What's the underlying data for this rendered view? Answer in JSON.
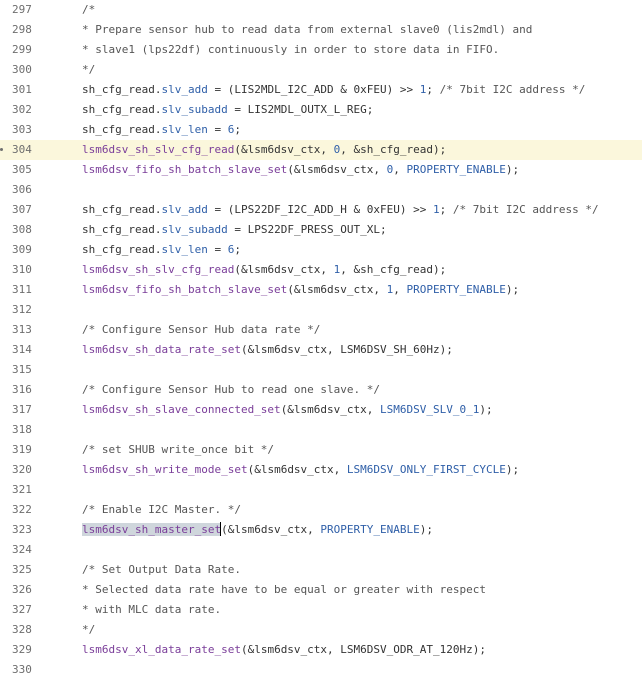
{
  "editor": {
    "highlighted_line": 304,
    "lines": [
      {
        "number": "297",
        "tokens": [
          {
            "t": "/*",
            "c": "comment"
          }
        ]
      },
      {
        "number": "298",
        "tokens": [
          {
            "t": "* Prepare sensor hub to read data from external slave0 (lis2mdl) and",
            "c": "comment"
          }
        ]
      },
      {
        "number": "299",
        "tokens": [
          {
            "t": "* slave1 (lps22df) continuously in order to store data in FIFO.",
            "c": "comment"
          }
        ]
      },
      {
        "number": "300",
        "tokens": [
          {
            "t": "*/",
            "c": "comment"
          }
        ]
      },
      {
        "number": "301",
        "tokens": [
          {
            "t": "sh_cfg_read.",
            "c": "text"
          },
          {
            "t": "slv_add",
            "c": "member"
          },
          {
            "t": " = (LIS2MDL_I2C_ADD & 0xFEU) >> ",
            "c": "text"
          },
          {
            "t": "1",
            "c": "num"
          },
          {
            "t": "; ",
            "c": "text"
          },
          {
            "t": "/* 7bit I2C address */",
            "c": "comment"
          }
        ]
      },
      {
        "number": "302",
        "tokens": [
          {
            "t": "sh_cfg_read.",
            "c": "text"
          },
          {
            "t": "slv_subadd",
            "c": "member"
          },
          {
            "t": " = LIS2MDL_OUTX_L_REG;",
            "c": "text"
          }
        ]
      },
      {
        "number": "303",
        "tokens": [
          {
            "t": "sh_cfg_read.",
            "c": "text"
          },
          {
            "t": "slv_len",
            "c": "member"
          },
          {
            "t": " = ",
            "c": "text"
          },
          {
            "t": "6",
            "c": "num"
          },
          {
            "t": ";",
            "c": "text"
          }
        ]
      },
      {
        "number": "304",
        "tokens": [
          {
            "t": "lsm6dsv_sh_slv_cfg_read",
            "c": "func"
          },
          {
            "t": "(&lsm6dsv_ctx, ",
            "c": "text"
          },
          {
            "t": "0",
            "c": "num"
          },
          {
            "t": ", &sh_cfg_read);",
            "c": "text"
          }
        ]
      },
      {
        "number": "305",
        "tokens": [
          {
            "t": "lsm6dsv_fifo_sh_batch_slave_set",
            "c": "func"
          },
          {
            "t": "(&lsm6dsv_ctx, ",
            "c": "text"
          },
          {
            "t": "0",
            "c": "num"
          },
          {
            "t": ", ",
            "c": "text"
          },
          {
            "t": "PROPERTY_ENABLE",
            "c": "enum"
          },
          {
            "t": ");",
            "c": "text"
          }
        ]
      },
      {
        "number": "306",
        "tokens": []
      },
      {
        "number": "307",
        "tokens": [
          {
            "t": "sh_cfg_read.",
            "c": "text"
          },
          {
            "t": "slv_add",
            "c": "member"
          },
          {
            "t": " = (LPS22DF_I2C_ADD_H & 0xFEU) >> ",
            "c": "text"
          },
          {
            "t": "1",
            "c": "num"
          },
          {
            "t": "; ",
            "c": "text"
          },
          {
            "t": "/* 7bit I2C address */",
            "c": "comment"
          }
        ]
      },
      {
        "number": "308",
        "tokens": [
          {
            "t": "sh_cfg_read.",
            "c": "text"
          },
          {
            "t": "slv_subadd",
            "c": "member"
          },
          {
            "t": " = LPS22DF_PRESS_OUT_XL;",
            "c": "text"
          }
        ]
      },
      {
        "number": "309",
        "tokens": [
          {
            "t": "sh_cfg_read.",
            "c": "text"
          },
          {
            "t": "slv_len",
            "c": "member"
          },
          {
            "t": " = ",
            "c": "text"
          },
          {
            "t": "6",
            "c": "num"
          },
          {
            "t": ";",
            "c": "text"
          }
        ]
      },
      {
        "number": "310",
        "tokens": [
          {
            "t": "lsm6dsv_sh_slv_cfg_read",
            "c": "func"
          },
          {
            "t": "(&lsm6dsv_ctx, ",
            "c": "text"
          },
          {
            "t": "1",
            "c": "num"
          },
          {
            "t": ", &sh_cfg_read);",
            "c": "text"
          }
        ]
      },
      {
        "number": "311",
        "tokens": [
          {
            "t": "lsm6dsv_fifo_sh_batch_slave_set",
            "c": "func"
          },
          {
            "t": "(&lsm6dsv_ctx, ",
            "c": "text"
          },
          {
            "t": "1",
            "c": "num"
          },
          {
            "t": ", ",
            "c": "text"
          },
          {
            "t": "PROPERTY_ENABLE",
            "c": "enum"
          },
          {
            "t": ");",
            "c": "text"
          }
        ]
      },
      {
        "number": "312",
        "tokens": []
      },
      {
        "number": "313",
        "tokens": [
          {
            "t": "/* Configure Sensor Hub data rate */",
            "c": "comment"
          }
        ]
      },
      {
        "number": "314",
        "tokens": [
          {
            "t": "lsm6dsv_sh_data_rate_set",
            "c": "func"
          },
          {
            "t": "(&lsm6dsv_ctx, LSM6DSV_SH_60Hz);",
            "c": "text"
          }
        ]
      },
      {
        "number": "315",
        "tokens": []
      },
      {
        "number": "316",
        "tokens": [
          {
            "t": "/* Configure Sensor Hub to read one slave. */",
            "c": "comment"
          }
        ]
      },
      {
        "number": "317",
        "tokens": [
          {
            "t": "lsm6dsv_sh_slave_connected_set",
            "c": "func"
          },
          {
            "t": "(&lsm6dsv_ctx, ",
            "c": "text"
          },
          {
            "t": "LSM6DSV_SLV_0_1",
            "c": "enum"
          },
          {
            "t": ");",
            "c": "text"
          }
        ]
      },
      {
        "number": "318",
        "tokens": []
      },
      {
        "number": "319",
        "tokens": [
          {
            "t": "/* set SHUB write_once bit */",
            "c": "comment"
          }
        ]
      },
      {
        "number": "320",
        "tokens": [
          {
            "t": "lsm6dsv_sh_write_mode_set",
            "c": "func"
          },
          {
            "t": "(&lsm6dsv_ctx, ",
            "c": "text"
          },
          {
            "t": "LSM6DSV_ONLY_FIRST_CYCLE",
            "c": "enum"
          },
          {
            "t": ");",
            "c": "text"
          }
        ]
      },
      {
        "number": "321",
        "tokens": []
      },
      {
        "number": "322",
        "tokens": [
          {
            "t": "/* Enable I2C Master. */",
            "c": "comment"
          }
        ]
      },
      {
        "number": "323",
        "tokens": [
          {
            "t": "lsm6dsv_sh_master_set",
            "c": "func",
            "sel": true
          },
          {
            "t": "",
            "c": "caret"
          },
          {
            "t": "(&lsm6dsv_ctx, ",
            "c": "text"
          },
          {
            "t": "PROPERTY_ENABLE",
            "c": "enum"
          },
          {
            "t": ");",
            "c": "text"
          }
        ]
      },
      {
        "number": "324",
        "tokens": []
      },
      {
        "number": "325",
        "tokens": [
          {
            "t": "/* Set Output Data Rate.",
            "c": "comment"
          }
        ]
      },
      {
        "number": "326",
        "tokens": [
          {
            "t": "* Selected data rate have to be equal or greater with respect",
            "c": "comment"
          }
        ]
      },
      {
        "number": "327",
        "tokens": [
          {
            "t": "* with MLC data rate.",
            "c": "comment"
          }
        ]
      },
      {
        "number": "328",
        "tokens": [
          {
            "t": "*/",
            "c": "comment"
          }
        ]
      },
      {
        "number": "329",
        "tokens": [
          {
            "t": "lsm6dsv_xl_data_rate_set",
            "c": "func"
          },
          {
            "t": "(&lsm6dsv_ctx, LSM6DSV_ODR_AT_120Hz);",
            "c": "text"
          }
        ]
      },
      {
        "number": "330",
        "tokens": []
      }
    ]
  }
}
